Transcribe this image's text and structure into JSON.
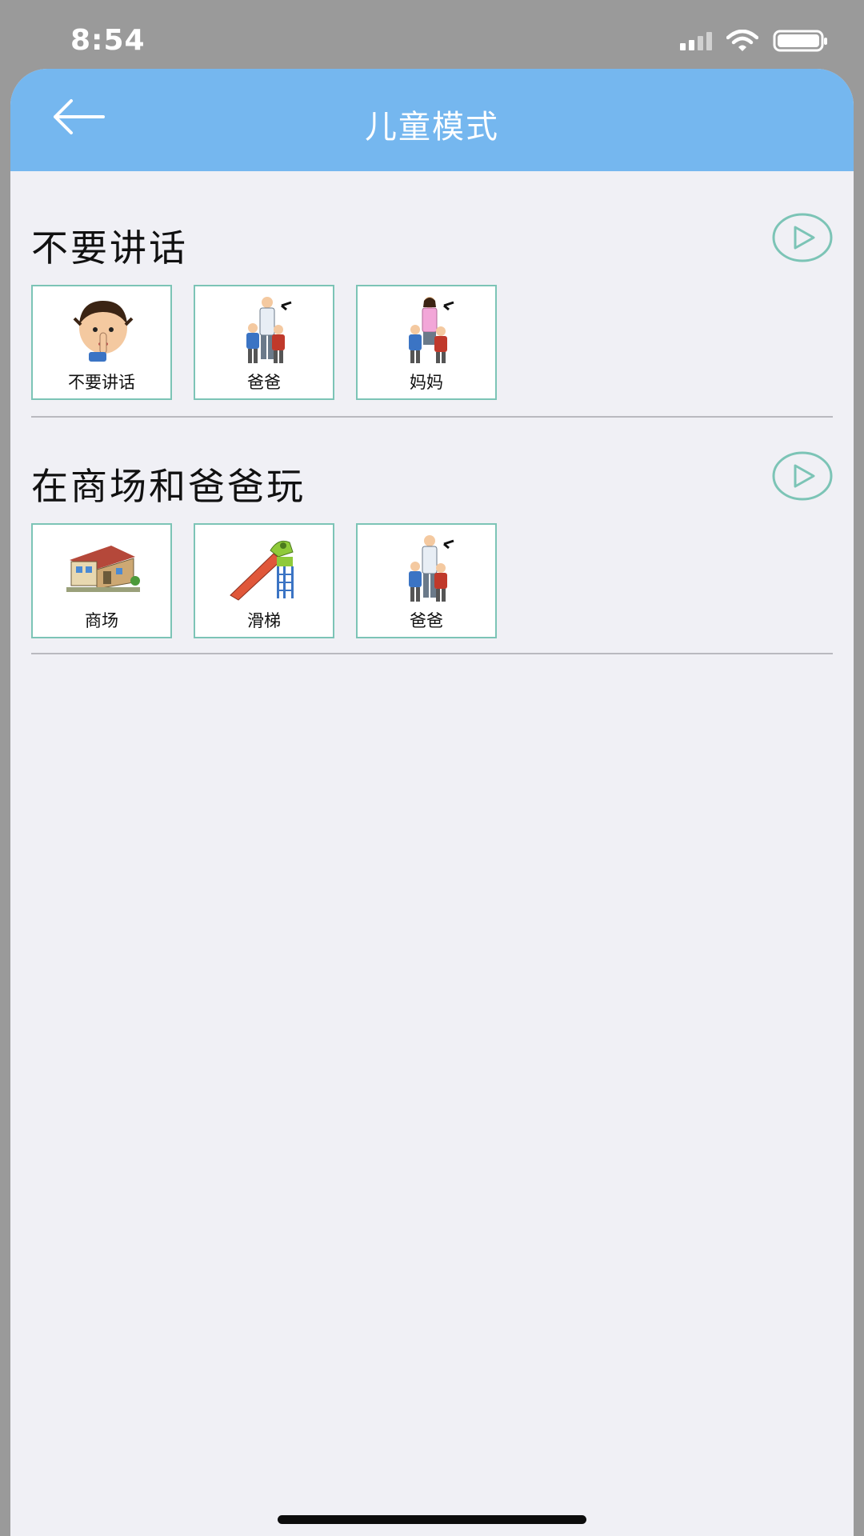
{
  "status_bar": {
    "time": "8:54"
  },
  "nav": {
    "title": "儿童模式",
    "back_icon": "arrow-left-icon"
  },
  "sections": [
    {
      "title": "不要讲话",
      "play_icon": "play-circle-icon",
      "tiles": [
        {
          "label": "不要讲话",
          "icon": "child-shush-icon"
        },
        {
          "label": "爸爸",
          "icon": "father-icon"
        },
        {
          "label": "妈妈",
          "icon": "mother-icon"
        }
      ]
    },
    {
      "title": "在商场和爸爸玩",
      "play_icon": "play-circle-icon",
      "tiles": [
        {
          "label": "商场",
          "icon": "mall-icon"
        },
        {
          "label": "滑梯",
          "icon": "slide-icon"
        },
        {
          "label": "爸爸",
          "icon": "father-icon"
        }
      ]
    }
  ],
  "colors": {
    "nav_background": "#75b7ef",
    "page_background": "#f0f0f5",
    "tile_border": "#7cc4b6",
    "play_icon": "#7cc4b6"
  }
}
